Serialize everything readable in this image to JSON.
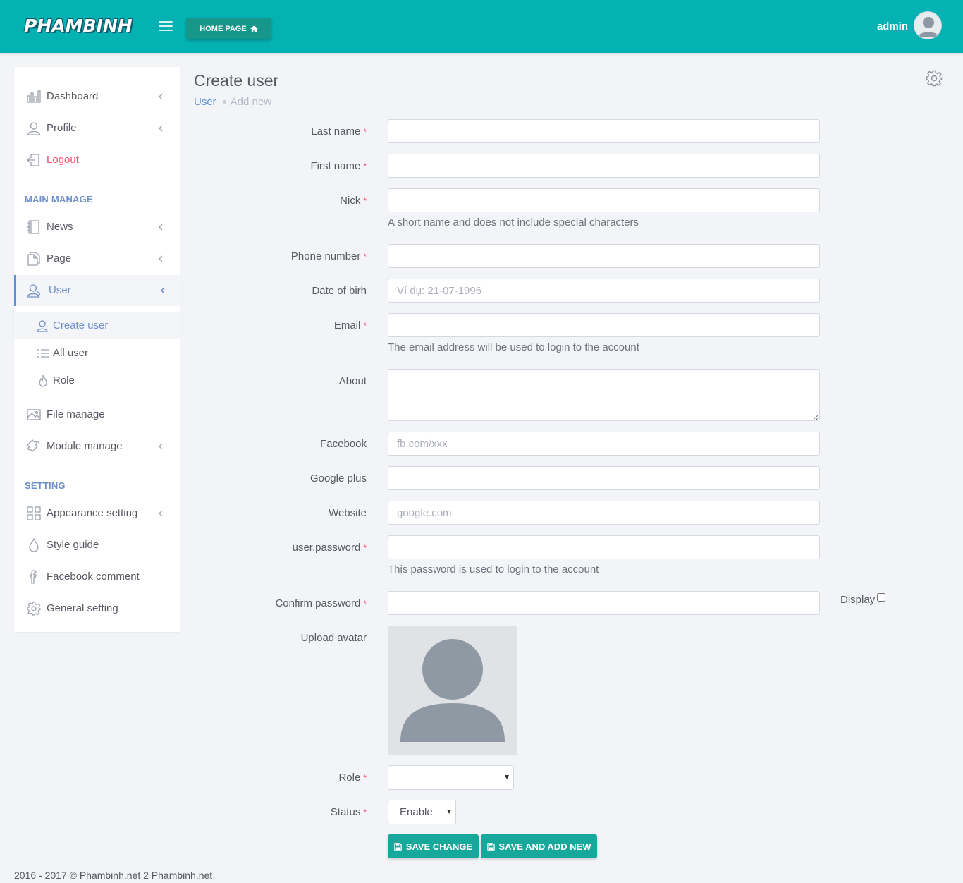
{
  "header": {
    "logo": "PHAMBINH",
    "home_button": "HOME PAGE",
    "user_name": "admin"
  },
  "sidebar": {
    "top_items": [
      {
        "label": "Dashboard",
        "icon": "bar-chart-icon"
      },
      {
        "label": "Profile",
        "icon": "user-icon"
      },
      {
        "label": "Logout",
        "icon": "logout-icon",
        "color": "#f4516c"
      }
    ],
    "main_manage_title": "MAIN MANAGE",
    "main_items": [
      {
        "label": "News",
        "icon": "notebook-icon"
      },
      {
        "label": "Page",
        "icon": "pages-icon"
      },
      {
        "label": "User",
        "icon": "users-icon",
        "active": true
      }
    ],
    "user_sub_items": [
      {
        "label": "Create user",
        "icon": "user-add-icon",
        "active": true
      },
      {
        "label": "All user",
        "icon": "list-icon"
      },
      {
        "label": "Role",
        "icon": "fire-icon"
      }
    ],
    "more_items": [
      {
        "label": "File manage",
        "icon": "image-icon"
      },
      {
        "label": "Module manage",
        "icon": "puzzle-icon"
      }
    ],
    "setting_title": "SETTING",
    "setting_items": [
      {
        "label": "Appearance setting",
        "icon": "grid-icon"
      },
      {
        "label": "Style guide",
        "icon": "drop-icon"
      },
      {
        "label": "Facebook comment",
        "icon": "facebook-icon"
      },
      {
        "label": "General setting",
        "icon": "gear-icon"
      }
    ]
  },
  "page": {
    "title": "Create user",
    "breadcrumb": [
      "User",
      "Add new"
    ]
  },
  "form": {
    "last_name": {
      "label": "Last name",
      "value": "",
      "required": true
    },
    "first_name": {
      "label": "First name",
      "value": "",
      "required": true
    },
    "nick": {
      "label": "Nick",
      "value": "",
      "required": true,
      "help": "A short name and does not include special characters"
    },
    "phone": {
      "label": "Phone number",
      "value": "",
      "required": true
    },
    "dob": {
      "label": "Date of birh",
      "placeholder": "Ví dụ: 21-07-1996"
    },
    "email": {
      "label": "Email",
      "value": "",
      "required": true,
      "help": "The email address will be used to login to the account"
    },
    "about": {
      "label": "About",
      "value": ""
    },
    "facebook": {
      "label": "Facebook",
      "placeholder": "fb.com/xxx"
    },
    "google": {
      "label": "Google plus",
      "value": ""
    },
    "website": {
      "label": "Website",
      "placeholder": "google.com"
    },
    "password": {
      "label": "user.password",
      "value": "",
      "required": true,
      "help": "This password is used to login to the account"
    },
    "confirm_password": {
      "label": "Confirm password",
      "value": "",
      "required": true
    },
    "display_label": "Display",
    "display_checked": false,
    "avatar_label": "Upload avatar",
    "role": {
      "label": "Role",
      "value": "",
      "required": true
    },
    "status": {
      "label": "Status",
      "value": "Enable",
      "required": true
    },
    "save_button": "SAVE CHANGE",
    "save_new_button": "SAVE AND ADD NEW",
    "required_mark": "*"
  },
  "footer": {
    "text": "2016 - 2017 © Phambinh.net 2 Phambinh.net"
  },
  "colors": {
    "header": "#04b1b3",
    "accent": "#16a89a",
    "link": "#5c8fd6",
    "danger": "#f4516c"
  }
}
